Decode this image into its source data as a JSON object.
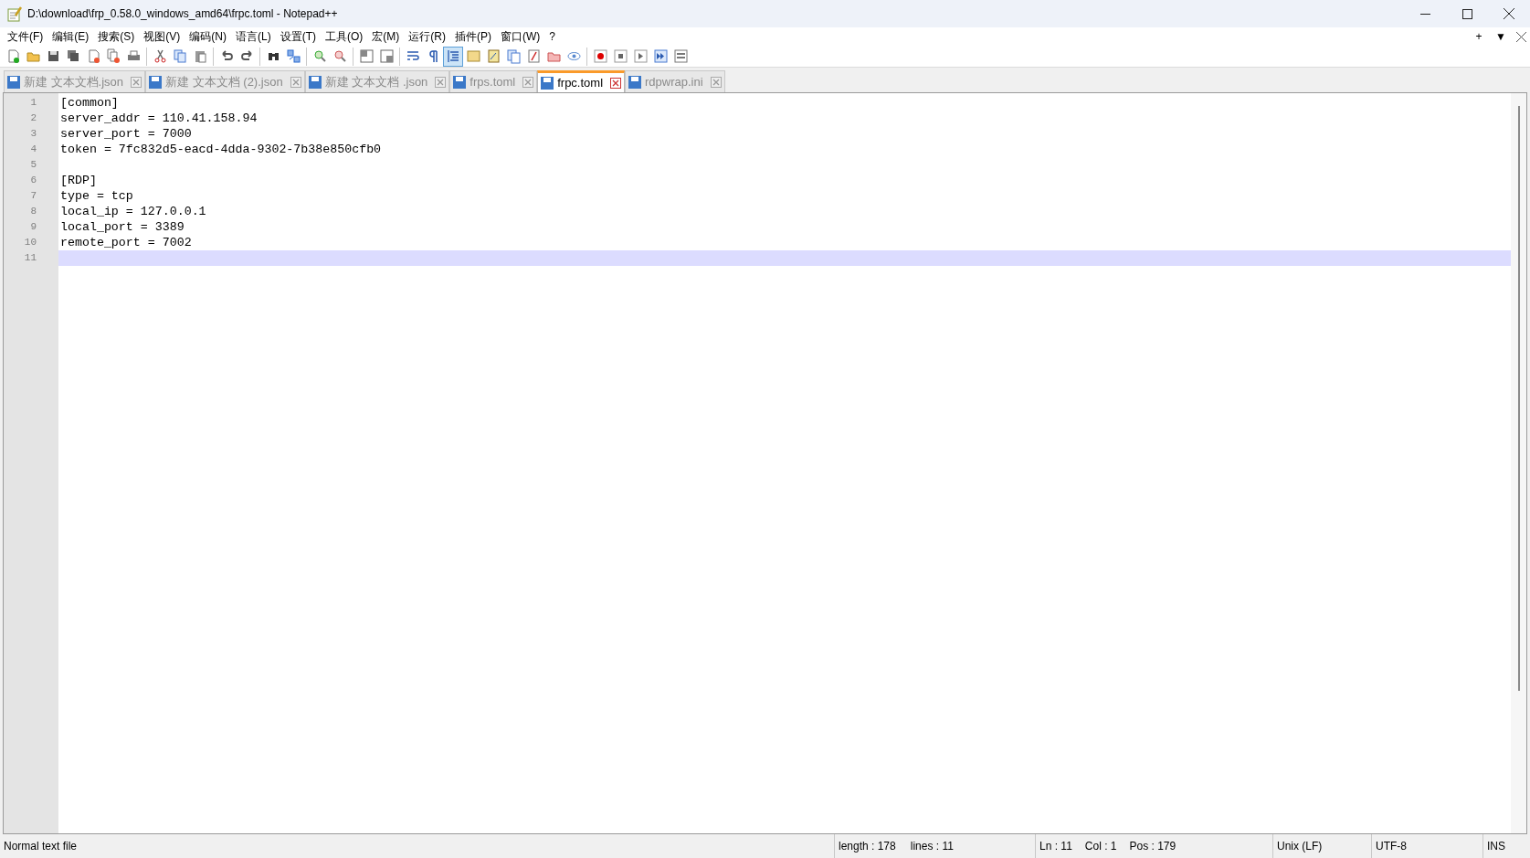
{
  "window": {
    "title": "D:\\download\\frp_0.58.0_windows_amd64\\frpc.toml - Notepad++"
  },
  "menu": [
    "文件(F)",
    "编辑(E)",
    "搜索(S)",
    "视图(V)",
    "编码(N)",
    "语言(L)",
    "设置(T)",
    "工具(O)",
    "宏(M)",
    "运行(R)",
    "插件(P)",
    "窗口(W)",
    "?"
  ],
  "menu_right": [
    "+",
    "▼"
  ],
  "toolbar": [
    {
      "kind": "new",
      "pressed": false
    },
    {
      "kind": "open",
      "pressed": false
    },
    {
      "kind": "save",
      "pressed": false
    },
    {
      "kind": "save-all",
      "pressed": false
    },
    {
      "kind": "close",
      "pressed": false
    },
    {
      "kind": "close-all",
      "pressed": false
    },
    {
      "kind": "print",
      "pressed": false
    },
    {
      "kind": "sep"
    },
    {
      "kind": "cut",
      "pressed": false
    },
    {
      "kind": "copy",
      "pressed": false
    },
    {
      "kind": "paste",
      "pressed": false
    },
    {
      "kind": "sep"
    },
    {
      "kind": "undo",
      "pressed": false
    },
    {
      "kind": "redo",
      "pressed": false
    },
    {
      "kind": "sep"
    },
    {
      "kind": "find",
      "pressed": false
    },
    {
      "kind": "replace",
      "pressed": false
    },
    {
      "kind": "sep"
    },
    {
      "kind": "zoom-in",
      "pressed": false
    },
    {
      "kind": "zoom-out",
      "pressed": false
    },
    {
      "kind": "sep"
    },
    {
      "kind": "sync-v",
      "pressed": false
    },
    {
      "kind": "sync-h",
      "pressed": false
    },
    {
      "kind": "sep"
    },
    {
      "kind": "wrap",
      "pressed": false
    },
    {
      "kind": "pilcrow",
      "pressed": false
    },
    {
      "kind": "indent",
      "pressed": true
    },
    {
      "kind": "lang",
      "pressed": false
    },
    {
      "kind": "docmap",
      "pressed": false
    },
    {
      "kind": "doclist",
      "pressed": false
    },
    {
      "kind": "func",
      "pressed": false
    },
    {
      "kind": "folder",
      "pressed": false
    },
    {
      "kind": "eye",
      "pressed": false
    },
    {
      "kind": "sep"
    },
    {
      "kind": "record",
      "pressed": false
    },
    {
      "kind": "stop",
      "pressed": false
    },
    {
      "kind": "play",
      "pressed": false
    },
    {
      "kind": "play-multi",
      "pressed": false
    },
    {
      "kind": "save-macro",
      "pressed": false
    }
  ],
  "tabs": [
    {
      "label": "新建 文本文档.json",
      "selected": false
    },
    {
      "label": "新建 文本文档 (2).json",
      "selected": false
    },
    {
      "label": "新建 文本文档 .json",
      "selected": false
    },
    {
      "label": "frps.toml",
      "selected": false
    },
    {
      "label": "frpc.toml",
      "selected": true
    },
    {
      "label": "rdpwrap.ini",
      "selected": false
    }
  ],
  "editor": {
    "lines": [
      {
        "number": "1",
        "text": "[common]",
        "current": false
      },
      {
        "number": "2",
        "text": "server_addr = 110.41.158.94",
        "current": false
      },
      {
        "number": "3",
        "text": "server_port = 7000",
        "current": false
      },
      {
        "number": "4",
        "text": "token = 7fc832d5-eacd-4dda-9302-7b38e850cfb0",
        "current": false
      },
      {
        "number": "5",
        "current": false
      },
      {
        "number": "6",
        "text": "[RDP]",
        "current": false
      },
      {
        "number": "7",
        "text": "type = tcp",
        "current": false
      },
      {
        "number": "8",
        "text": "local_ip = 127.0.0.1",
        "current": false
      },
      {
        "number": "9",
        "text": "local_port = 3389",
        "current": false
      },
      {
        "number": "10",
        "text": "remote_port = 7002",
        "current": false
      },
      {
        "number": "11",
        "current": true
      }
    ]
  },
  "status_bar": {
    "file_type": "Normal text file",
    "length": "length : 178",
    "lines": "lines : 11",
    "ln": "Ln : 11",
    "col": "Col : 1",
    "pos": "Pos : 179",
    "eol": "Unix (LF)",
    "encoding": "UTF-8",
    "mode": "INS"
  }
}
